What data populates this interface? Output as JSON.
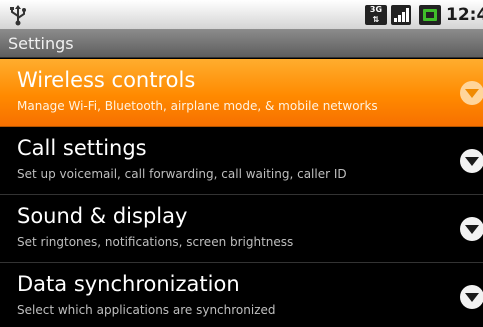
{
  "status_bar": {
    "network_type": "3G",
    "time": "12:4",
    "icons": [
      "usb-icon",
      "3g-icon",
      "signal-icon",
      "battery-icon"
    ]
  },
  "title_bar": {
    "title": "Settings"
  },
  "settings": {
    "items": [
      {
        "title": "Wireless controls",
        "summary": "Manage Wi-Fi, Bluetooth, airplane mode, & mobile networks",
        "selected": true
      },
      {
        "title": "Call settings",
        "summary": "Set up voicemail, call forwarding, call waiting, caller ID",
        "selected": false
      },
      {
        "title": "Sound & display",
        "summary": "Set ringtones, notifications, screen brightness",
        "selected": false
      },
      {
        "title": "Data synchronization",
        "summary": "Select which applications are synchronized",
        "selected": false
      }
    ]
  },
  "colors": {
    "highlight": "#ff8a00",
    "background": "#000000",
    "status_bar": "#e8e8e8",
    "title_bar": "#6e6e6e"
  }
}
